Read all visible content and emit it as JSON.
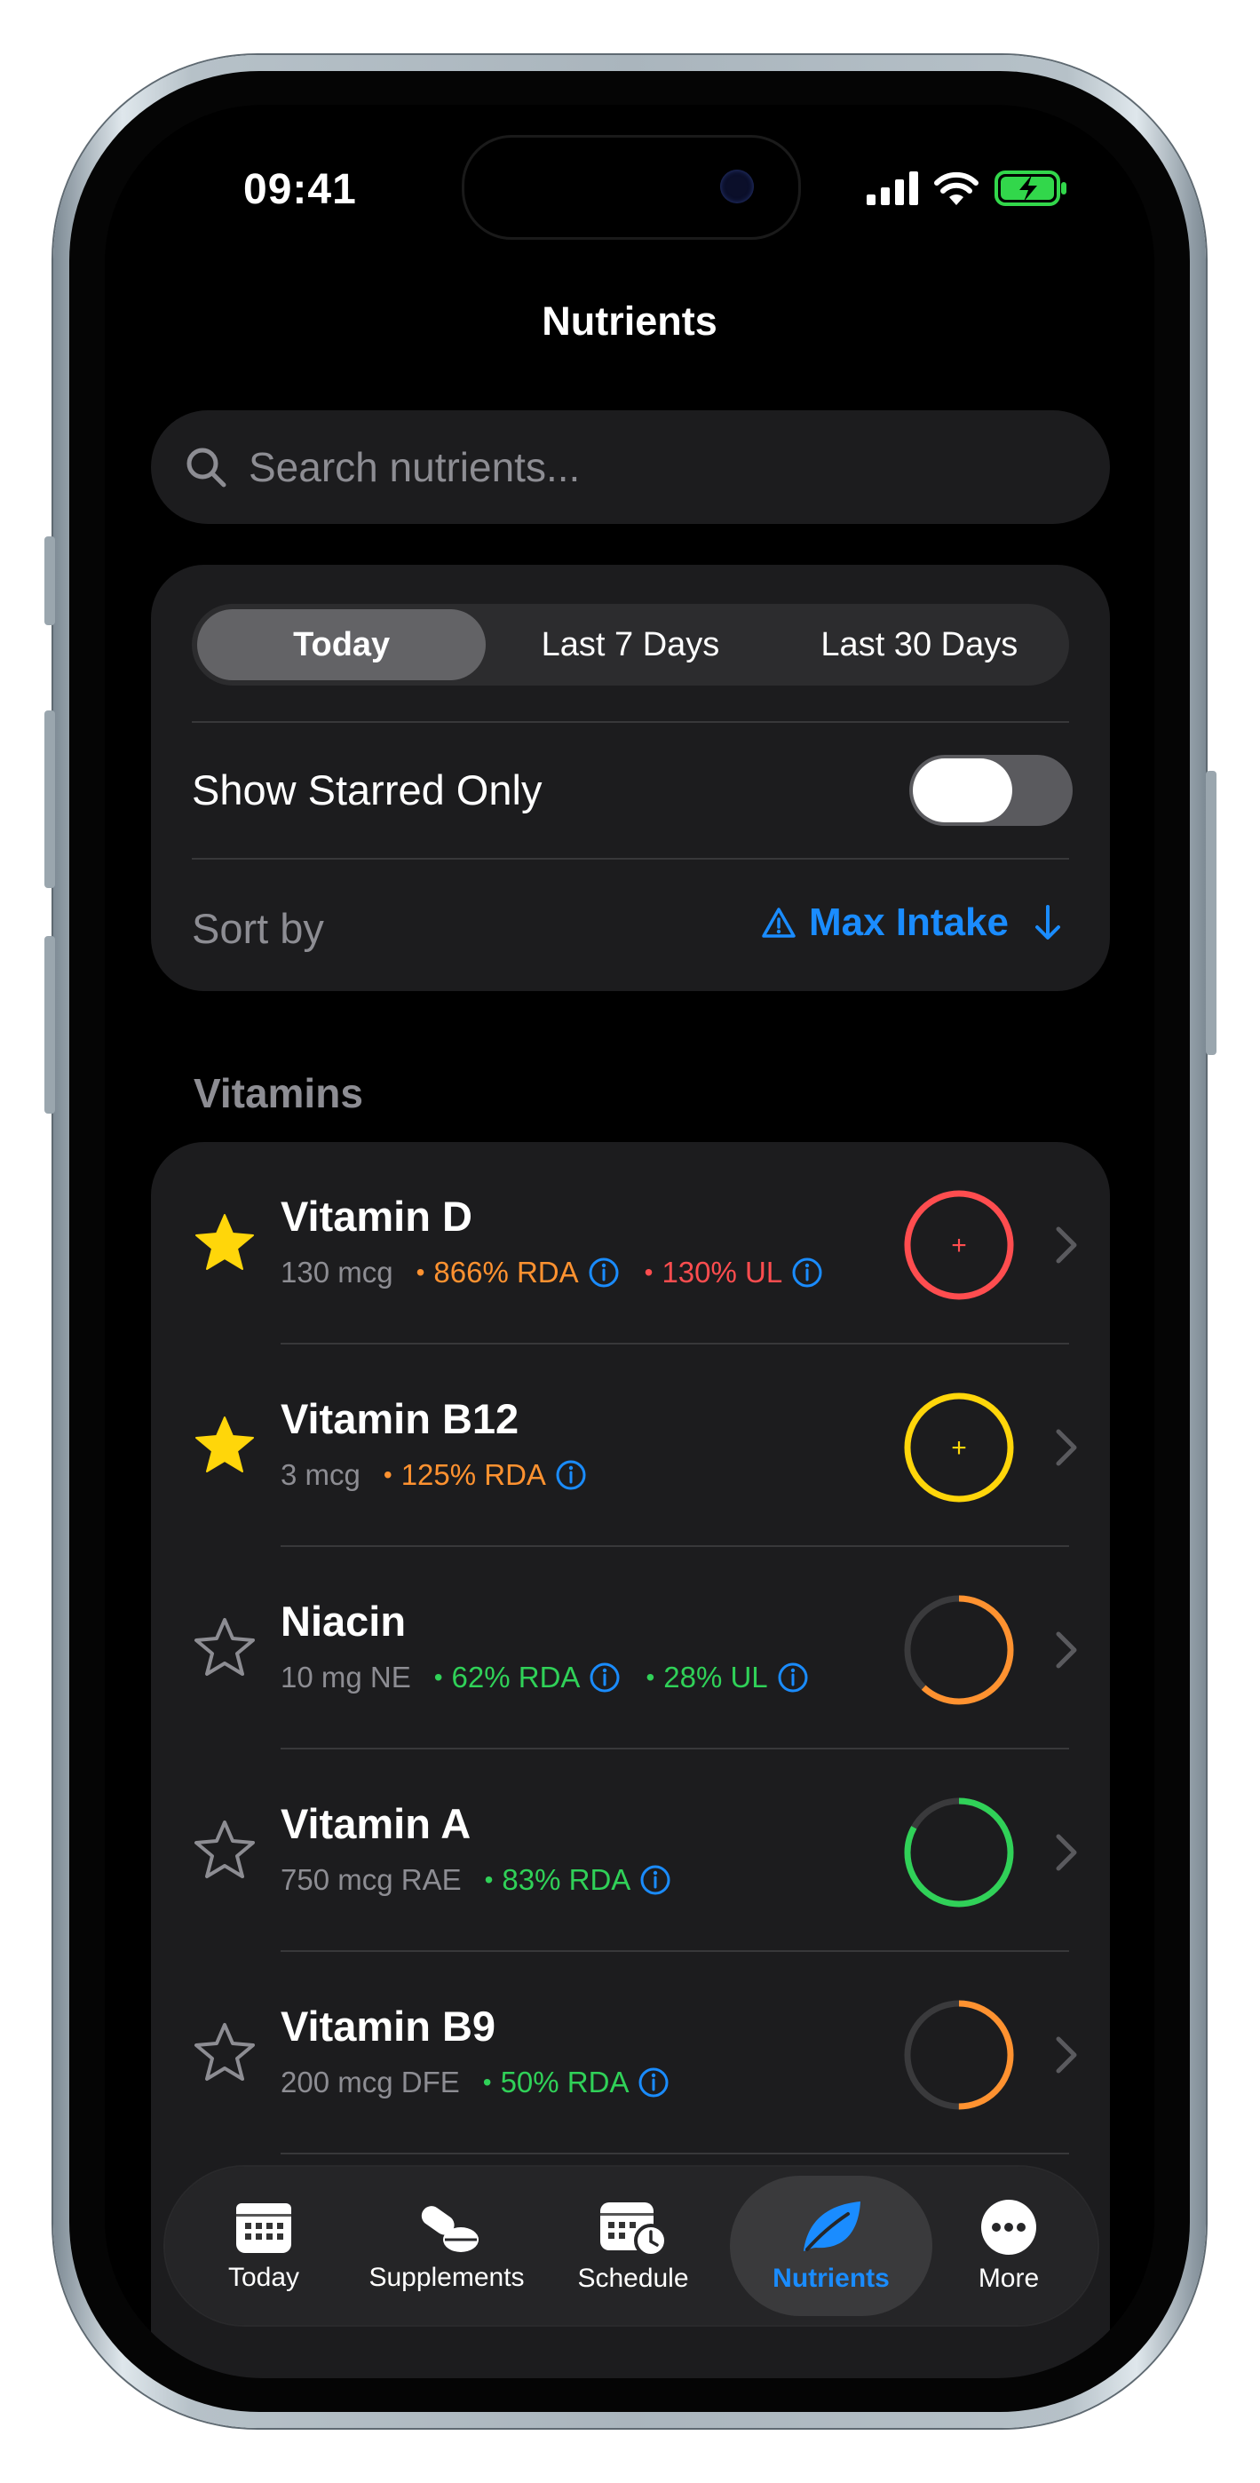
{
  "status_bar": {
    "time": "09:41"
  },
  "header": {
    "title": "Nutrients"
  },
  "search": {
    "placeholder": "Search nutrients..."
  },
  "filters": {
    "periods": [
      {
        "label": "Today",
        "selected": true
      },
      {
        "label": "Last 7 Days",
        "selected": false
      },
      {
        "label": "Last 30 Days",
        "selected": false
      }
    ],
    "starred_label": "Show Starred Only",
    "starred_on": false,
    "sort_label": "Sort by",
    "sort_value": "Max Intake"
  },
  "section": {
    "title": "Vitamins"
  },
  "nutrients": [
    {
      "name": "Vitamin D",
      "amount": "130 mcg",
      "starred": true,
      "rda": "866% RDA",
      "rda_color": "#ff9230",
      "ul": "130% UL",
      "ul_color": "#ff4d4f",
      "ring_color": "#ff4d4f",
      "ring_fraction": 1.0,
      "ring_plus": true
    },
    {
      "name": "Vitamin B12",
      "amount": "3 mcg",
      "starred": true,
      "rda": "125% RDA",
      "rda_color": "#ff9230",
      "ul": null,
      "ul_color": null,
      "ring_color": "#ffd60a",
      "ring_fraction": 1.0,
      "ring_plus": true
    },
    {
      "name": "Niacin",
      "amount": "10 mg NE",
      "starred": false,
      "rda": "62% RDA",
      "rda_color": "#30d158",
      "ul": "28% UL",
      "ul_color": "#30d158",
      "ring_color": "#ff9230",
      "ring_fraction": 0.62,
      "ring_plus": false
    },
    {
      "name": "Vitamin A",
      "amount": "750 mcg RAE",
      "starred": false,
      "rda": "83% RDA",
      "rda_color": "#30d158",
      "ul": null,
      "ul_color": null,
      "ring_color": "#30d158",
      "ring_fraction": 0.83,
      "ring_plus": false
    },
    {
      "name": "Vitamin B9",
      "amount": "200 mcg DFE",
      "starred": false,
      "rda": "50% RDA",
      "rda_color": "#30d158",
      "ul": null,
      "ul_color": null,
      "ring_color": "#ff9230",
      "ring_fraction": 0.5,
      "ring_plus": false
    }
  ],
  "tabbar": [
    {
      "label": "Today",
      "icon": "calendar-icon",
      "selected": false
    },
    {
      "label": "Supplements",
      "icon": "pills-icon",
      "selected": false
    },
    {
      "label": "Schedule",
      "icon": "calendar-clock-icon",
      "selected": false
    },
    {
      "label": "Nutrients",
      "icon": "leaf-icon",
      "selected": true
    },
    {
      "label": "More",
      "icon": "more-icon",
      "selected": false
    }
  ],
  "colors": {
    "accent": "#1a8cff",
    "star": "#ffd60a",
    "card": "#1c1c1e"
  }
}
